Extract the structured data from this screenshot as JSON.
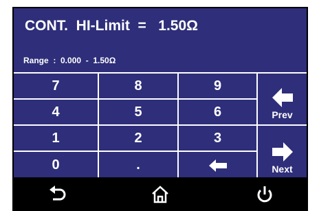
{
  "header": {
    "title": "CONT.  HI-Limit  =   1.50Ω",
    "range": "Range  :  0.000  -  1.50Ω"
  },
  "keypad": {
    "k7": "7",
    "k8": "8",
    "k9": "9",
    "k4": "4",
    "k5": "5",
    "k6": "6",
    "k1": "1",
    "k2": "2",
    "k3": "3",
    "k0": "0",
    "kdot": "."
  },
  "side": {
    "prev_label": "Prev",
    "next_label": "Next"
  },
  "colors": {
    "panel": "#2e2e7a",
    "text": "#ffffff",
    "bottom_bar": "#000000"
  },
  "icons": {
    "backspace": "left-arrow-icon",
    "prev": "left-arrow-icon",
    "next": "right-arrow-icon",
    "back": "back-icon",
    "home": "home-icon",
    "power": "power-icon"
  }
}
